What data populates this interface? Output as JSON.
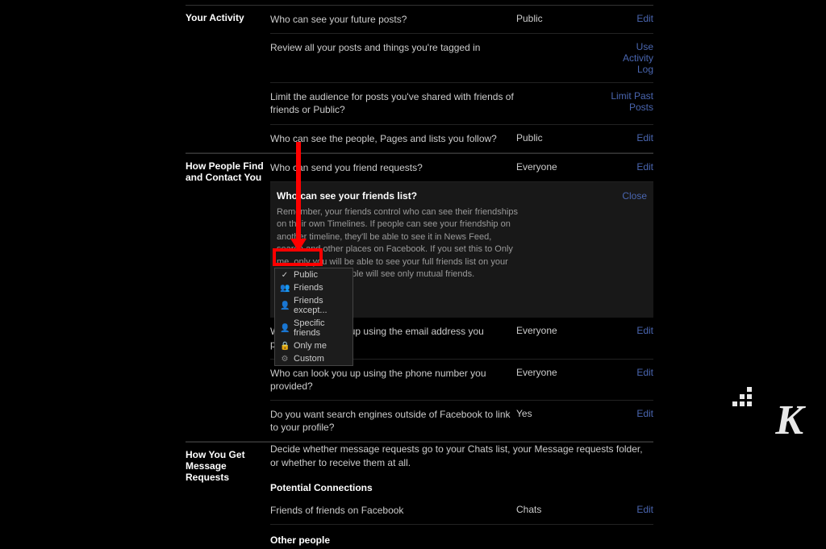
{
  "sections": {
    "activity": {
      "title": "Your Activity",
      "rows": [
        {
          "label": "Who can see your future posts?",
          "value": "Public",
          "action": "Edit"
        },
        {
          "label": "Review all your posts and things you're tagged in",
          "value": "",
          "action": "Use Activity Log"
        },
        {
          "label": "Limit the audience for posts you've shared with friends of friends or Public?",
          "value": "",
          "action": "Limit Past Posts"
        },
        {
          "label": "Who can see the people, Pages and lists you follow?",
          "value": "Public",
          "action": "Edit"
        }
      ]
    },
    "contact": {
      "title": "How People Find and Contact You",
      "r0": {
        "label": "Who can send you friend requests?",
        "value": "Everyone",
        "action": "Edit"
      },
      "expanded": {
        "title": "Who can see your friends list?",
        "close": "Close",
        "desc": "Remember, your friends control who can see their friendships on their own Timelines. If people can see your friendship on another timeline, they'll be able to see it in News Feed, search and other places on Facebook. If you set this to Only me, only you will be able to see your full friends list on your timeline. Other people will see only mutual friends.",
        "selected": "Public",
        "options": [
          "Public",
          "Friends",
          "Friends except...",
          "Specific friends",
          "Only me",
          "Custom"
        ]
      },
      "r2": {
        "label": "Who can look you up using the email address you provided?",
        "value": "Everyone",
        "action": "Edit"
      },
      "r3": {
        "label": "Who can look you up using the phone number you provided?",
        "value": "Everyone",
        "action": "Edit"
      },
      "r4": {
        "label": "Do you want search engines outside of Facebook to link to your profile?",
        "value": "Yes",
        "action": "Edit"
      }
    },
    "messages": {
      "title": "How You Get Message Requests",
      "desc": "Decide whether message requests go to your Chats list, your Message requests folder, or whether to receive them at all.",
      "sub": "Potential Connections",
      "r0": {
        "label": "Friends of friends on Facebook",
        "value": "Chats",
        "action": "Edit"
      },
      "other": "Other people"
    }
  }
}
